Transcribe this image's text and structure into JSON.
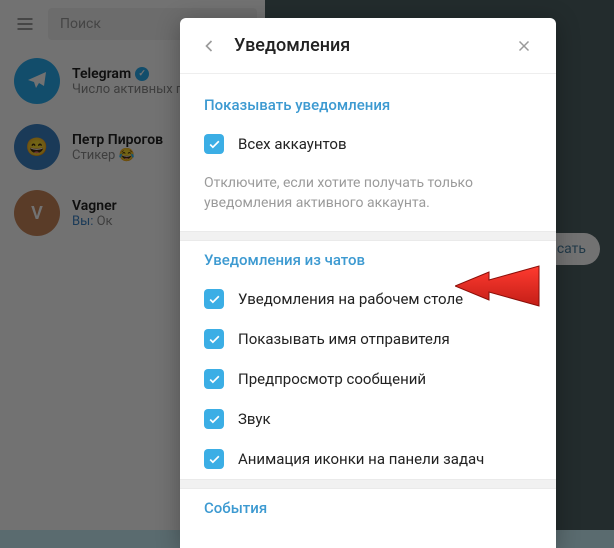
{
  "sidebar": {
    "search_placeholder": "Поиск",
    "chats": [
      {
        "title": "Telegram",
        "verified": true,
        "subtitle": "Число активных пользователей"
      },
      {
        "title": "Петр Пирогов",
        "subtitle": "Стикер 😂"
      },
      {
        "title": "Vagner",
        "you_prefix": "Вы:",
        "subtitle": "Ок"
      }
    ]
  },
  "main": {
    "write_button": "написать"
  },
  "modal": {
    "title": "Уведомления",
    "section1_title": "Показывать уведомления",
    "all_accounts_label": "Всех аккаунтов",
    "hint": "Отключите, если хотите получать только уведомления активного аккаунта.",
    "section2_title": "Уведомления из чатов",
    "chat_settings": [
      "Уведомления на рабочем столе",
      "Показывать имя отправителя",
      "Предпросмотр сообщений",
      "Звук",
      "Анимация иконки на панели задач"
    ],
    "section3_title": "События"
  }
}
